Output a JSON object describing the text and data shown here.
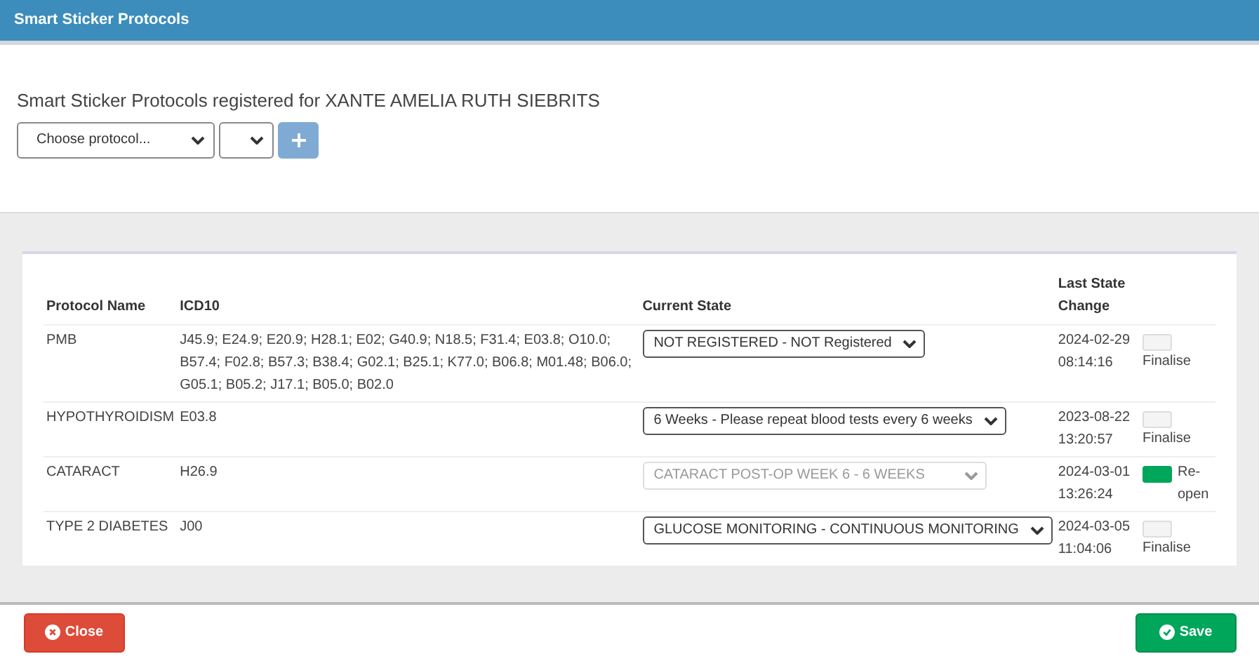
{
  "window": {
    "title": "Smart Sticker Protocols"
  },
  "heading": "Smart Sticker Protocols registered for XANTE AMELIA RUTH SIEBRITS",
  "protocol_select": {
    "value": "Choose protocol..."
  },
  "table": {
    "columns": [
      "Protocol Name",
      "ICD10",
      "Current State",
      "Last State Change"
    ],
    "rows": [
      {
        "name": "PMB",
        "icd10": "J45.9; E24.9; E20.9; H28.1; E02; G40.9; N18.5; F31.4; E03.8; O10.0; B57.4; F02.8; B57.3; B38.4; G02.1; B25.1; K77.0; B06.8; M01.48; B06.0; G05.1; B05.2; J17.1; B05.0; B02.0",
        "state": "NOT REGISTERED - NOT Registered",
        "disabled": false,
        "changed": "2024-02-29 08:14:16",
        "on": false,
        "action": "Finalise"
      },
      {
        "name": "HYPOTHYROIDISM",
        "icd10": "E03.8",
        "state": "6 Weeks - Please repeat blood tests every 6 weeks",
        "disabled": false,
        "changed": "2023-08-22 13:20:57",
        "on": false,
        "action": "Finalise"
      },
      {
        "name": "CATARACT",
        "icd10": "H26.9",
        "state": "CATARACT POST-OP WEEK 6 - 6 WEEKS",
        "disabled": true,
        "changed": "2024-03-01 13:26:24",
        "on": true,
        "action": "Re-open"
      },
      {
        "name": "TYPE 2 DIABETES",
        "icd10": "J00",
        "state": "GLUCOSE MONITORING - CONTINUOUS MONITORING",
        "disabled": false,
        "changed": "2024-03-05 11:04:06",
        "on": false,
        "action": "Finalise"
      }
    ]
  },
  "buttons": {
    "close": "Close",
    "save": "Save"
  }
}
